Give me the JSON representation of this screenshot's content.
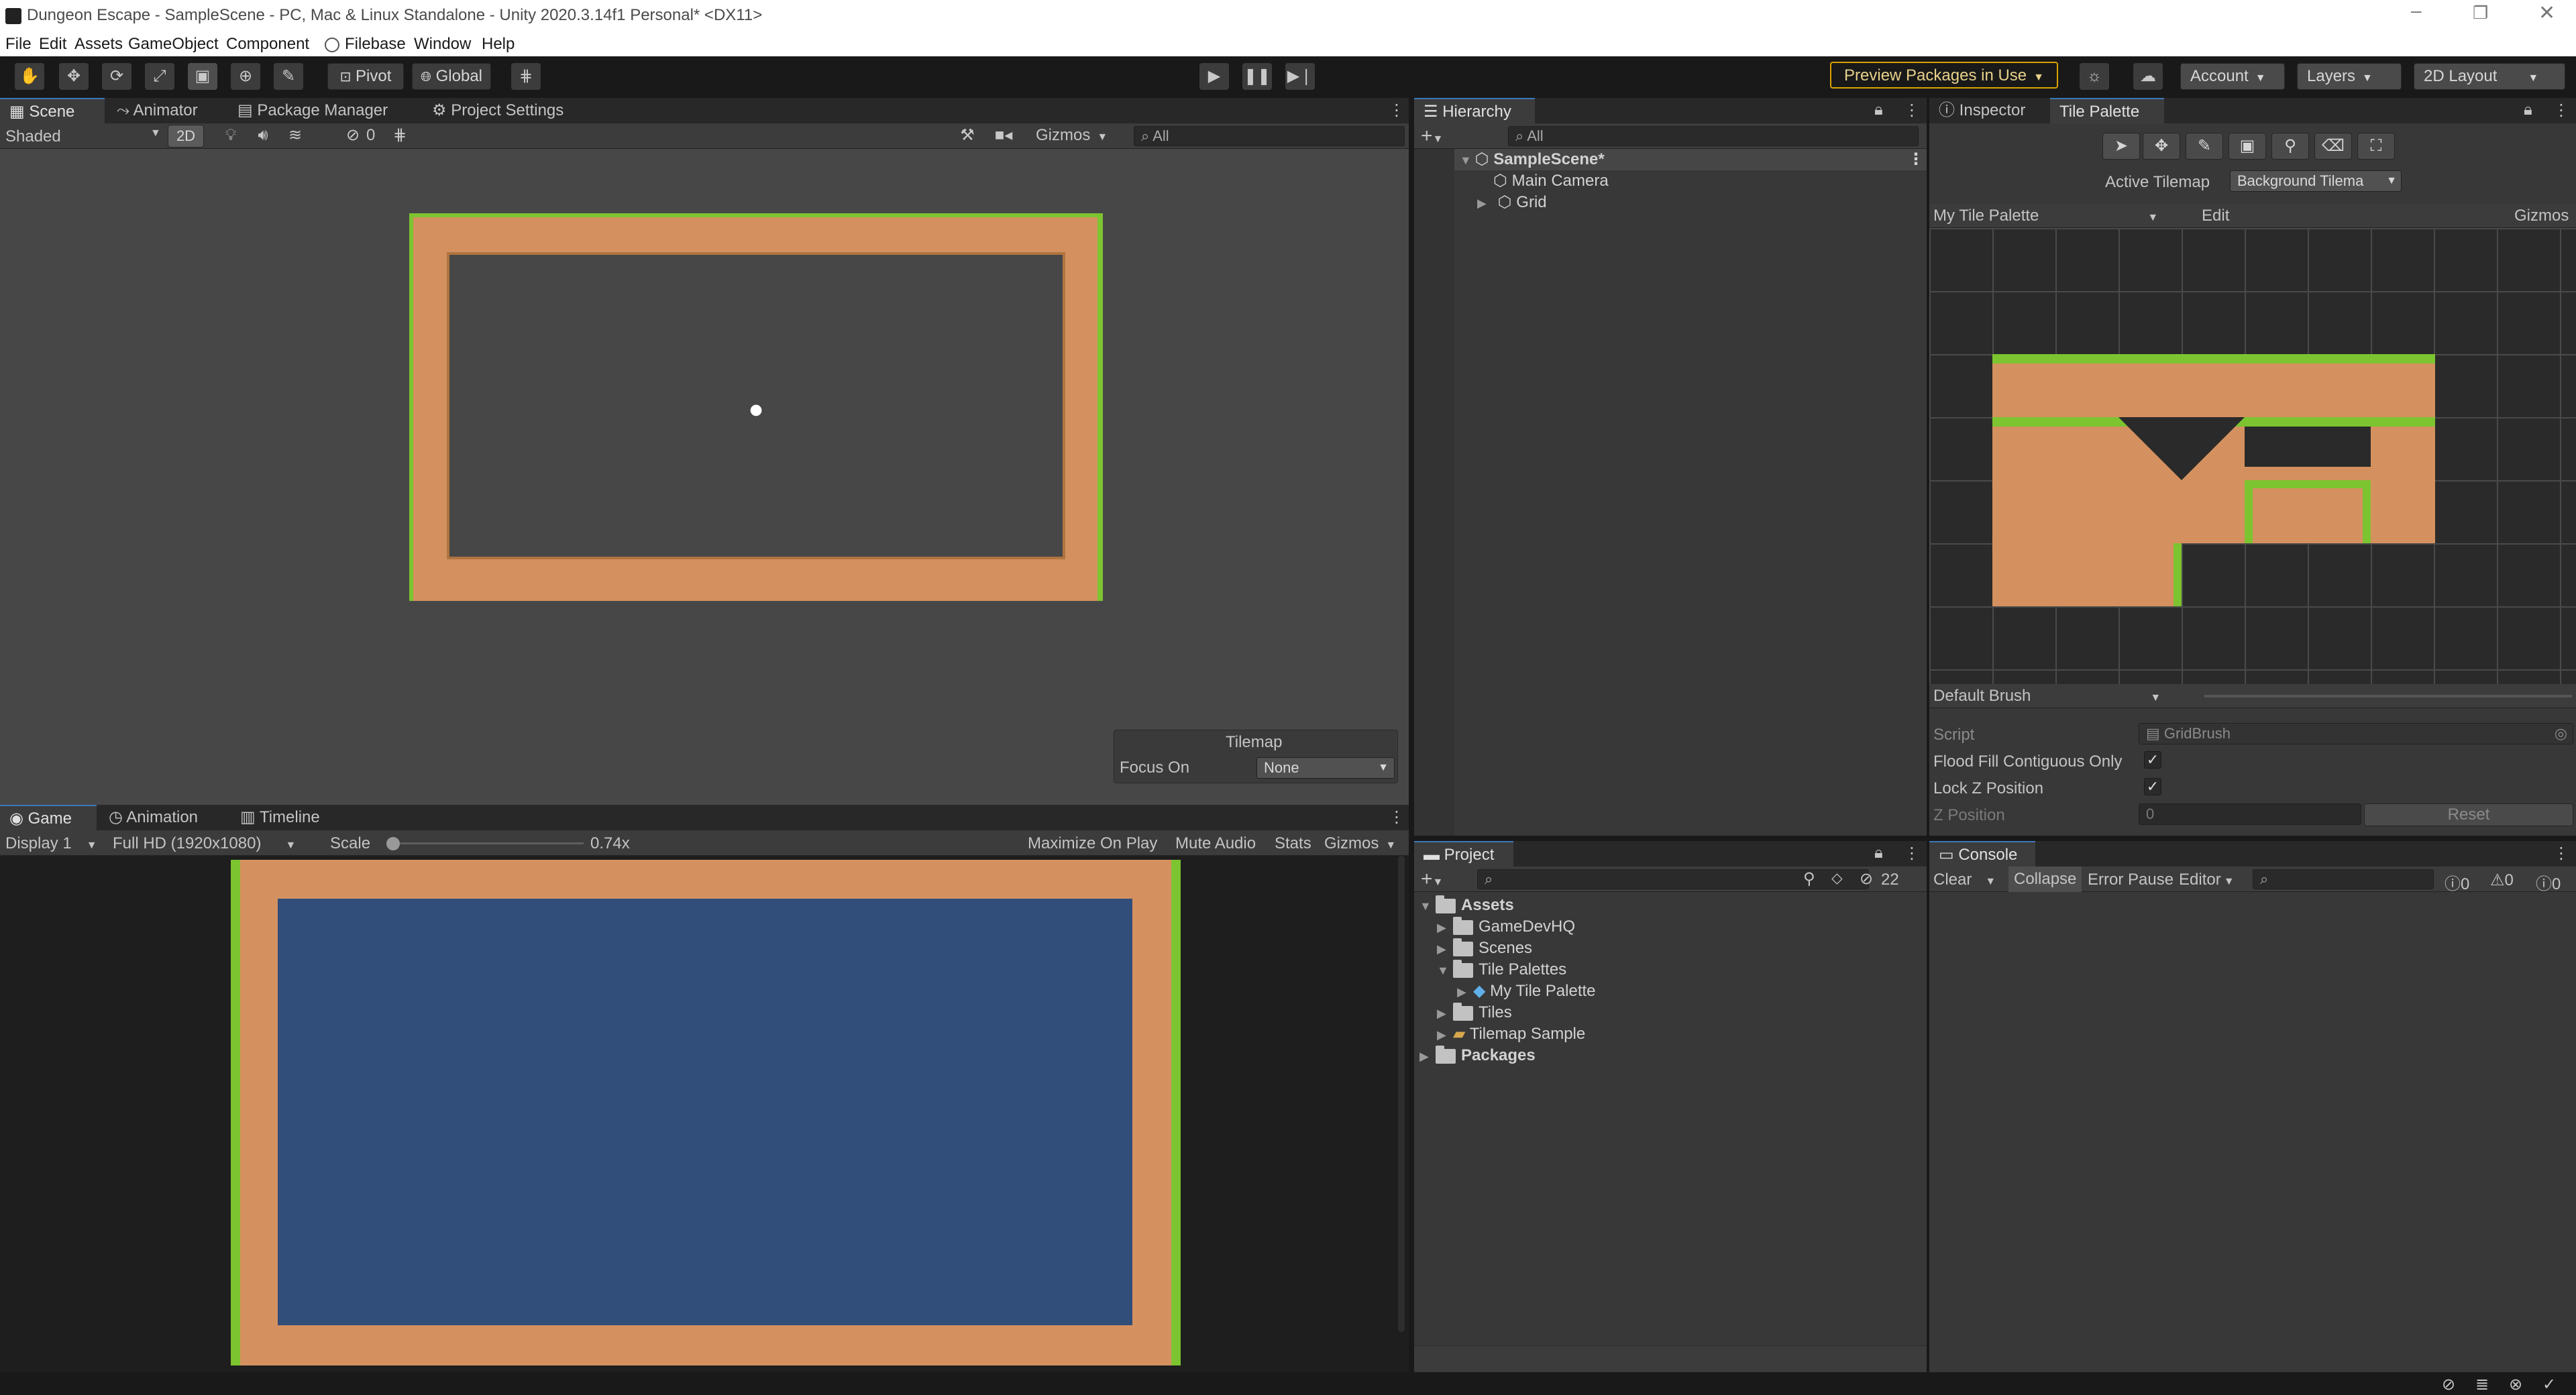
{
  "window": {
    "title": "Dungeon Escape - SampleScene - PC, Mac & Linux Standalone - Unity 2020.3.14f1 Personal* <DX11>"
  },
  "menu": [
    "File",
    "Edit",
    "Assets",
    "GameObject",
    "Component",
    "Filebase",
    "Window",
    "Help"
  ],
  "toolbar": {
    "pivot": "Pivot",
    "global": "Global",
    "preview_packages": "Preview Packages in Use",
    "account": "Account",
    "layers": "Layers",
    "layout": "2D Layout"
  },
  "scene_panel": {
    "tabs": [
      "Scene",
      "Animator",
      "Package Manager",
      "Project Settings"
    ],
    "shading": "Shaded",
    "mode_2d": "2D",
    "hidden_count": "0",
    "gizmos": "Gizmos",
    "search_placeholder": "All",
    "overlay": {
      "title": "Tilemap",
      "focus_label": "Focus On",
      "focus_value": "None"
    }
  },
  "game_panel": {
    "tabs": [
      "Game",
      "Animation",
      "Timeline"
    ],
    "display": "Display 1",
    "resolution": "Full HD (1920x1080)",
    "scale_label": "Scale",
    "scale_value": "0.74x",
    "scale_fraction": 0.02,
    "maximize": "Maximize On Play",
    "mute": "Mute Audio",
    "stats": "Stats",
    "gizmos": "Gizmos"
  },
  "hierarchy": {
    "tab": "Hierarchy",
    "search_placeholder": "All",
    "scene": "SampleScene*",
    "items": [
      "Main Camera",
      "Grid"
    ]
  },
  "inspector": {
    "tabs": [
      "Inspector",
      "Tile Palette"
    ],
    "active_tilemap_label": "Active Tilemap",
    "active_tilemap_value": "Background Tilema",
    "palette": "My Tile Palette",
    "edit": "Edit",
    "gizmos": "Gizmos",
    "brush": "Default Brush",
    "script_label": "Script",
    "script_value": "GridBrush",
    "flood_fill_label": "Flood Fill Contiguous Only",
    "flood_fill_checked": true,
    "lock_z_label": "Lock Z Position",
    "lock_z_checked": true,
    "z_label": "Z Position",
    "z_value": "0",
    "reset": "Reset"
  },
  "project": {
    "tab": "Project",
    "hidden_count": "22",
    "assets": "Assets",
    "folders": [
      "GameDevHQ",
      "Scenes",
      "Tile Palettes",
      "My Tile Palette",
      "Tiles",
      "Tilemap Sample"
    ],
    "packages": "Packages"
  },
  "console": {
    "tab": "Console",
    "clear": "Clear",
    "collapse": "Collapse",
    "error_pause": "Error Pause",
    "editor": "Editor",
    "log_count": "0",
    "warn_count": "0",
    "error_count": "0"
  },
  "colors": {
    "accent": "#3a79bb",
    "grass": "#7cc430",
    "dirt": "#d4915f",
    "game_bg": "#314d79",
    "preview_border": "#d9a300"
  }
}
